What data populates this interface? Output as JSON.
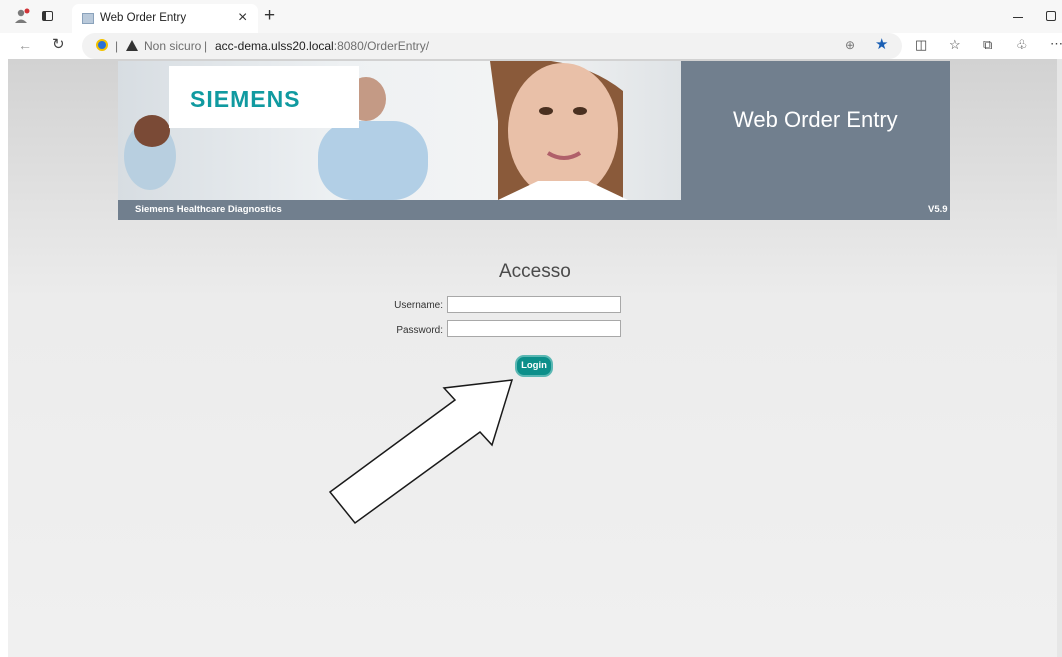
{
  "browser": {
    "tab_title": "Web Order Entry",
    "tab_close": "×",
    "new_tab": "+",
    "security_label": "Non sicuro",
    "url_host": "acc-dema.ulss20.local",
    "url_rest": ":8080/OrderEntry/",
    "separator": "|"
  },
  "banner": {
    "logo": "SIEMENS",
    "title": "Web Order Entry",
    "company": "Siemens Healthcare Diagnostics",
    "version": "V5.9"
  },
  "login": {
    "heading": "Accesso",
    "username_label": "Username:",
    "password_label": "Password:",
    "username_value": "",
    "password_value": "",
    "button_label": "Login"
  },
  "colors": {
    "accent": "#0c8f8a",
    "header_bg": "#717f8e",
    "logo": "#109aa0"
  }
}
